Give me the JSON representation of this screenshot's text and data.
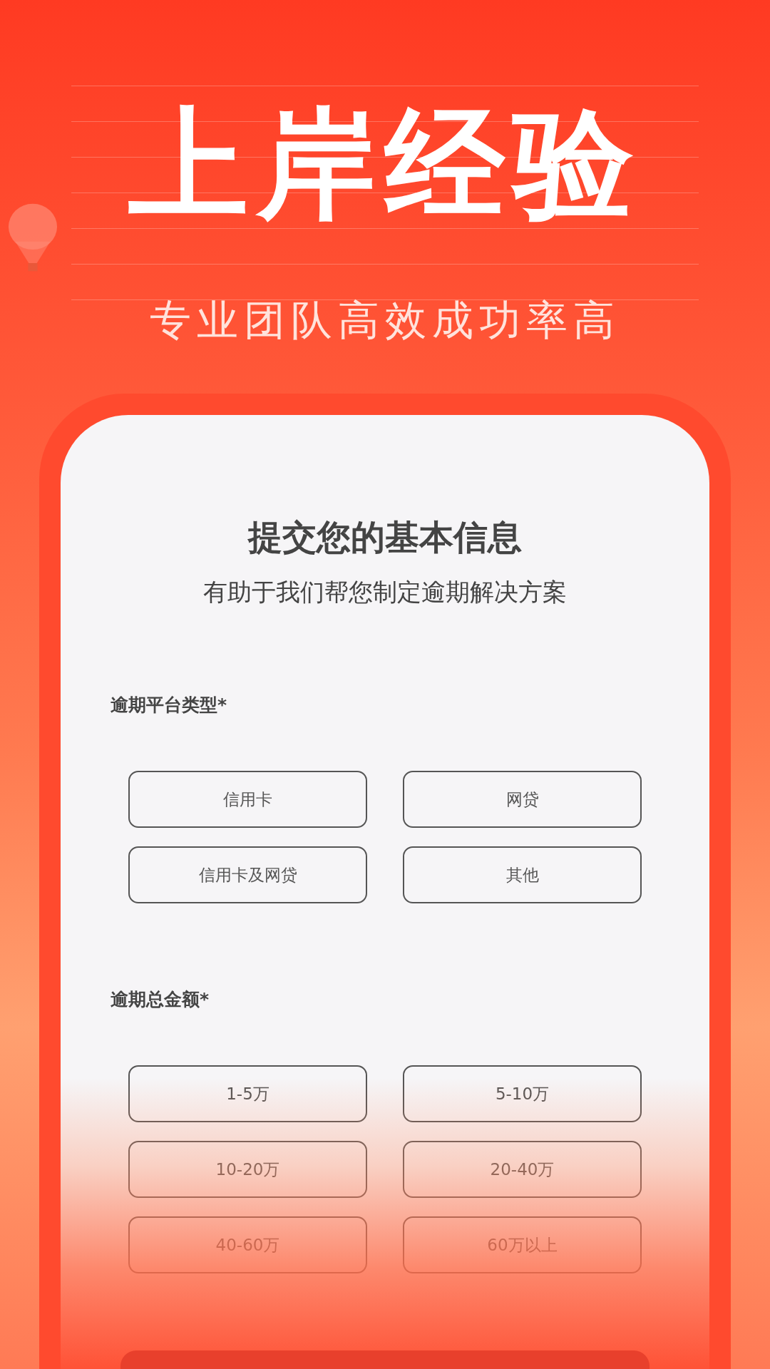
{
  "headline": "上岸经验",
  "tagline": "专业团队高效成功率高",
  "form": {
    "title": "提交您的基本信息",
    "subtitle": "有助于我们帮您制定逾期解决方案",
    "sections": [
      {
        "label": "逾期平台类型*",
        "options": [
          "信用卡",
          "网贷",
          "信用卡及网贷",
          "其他"
        ]
      },
      {
        "label": "逾期总金额*",
        "options": [
          "1-5万",
          "5-10万",
          "10-20万",
          "20-40万",
          "40-60万",
          "60万以上"
        ]
      }
    ]
  }
}
